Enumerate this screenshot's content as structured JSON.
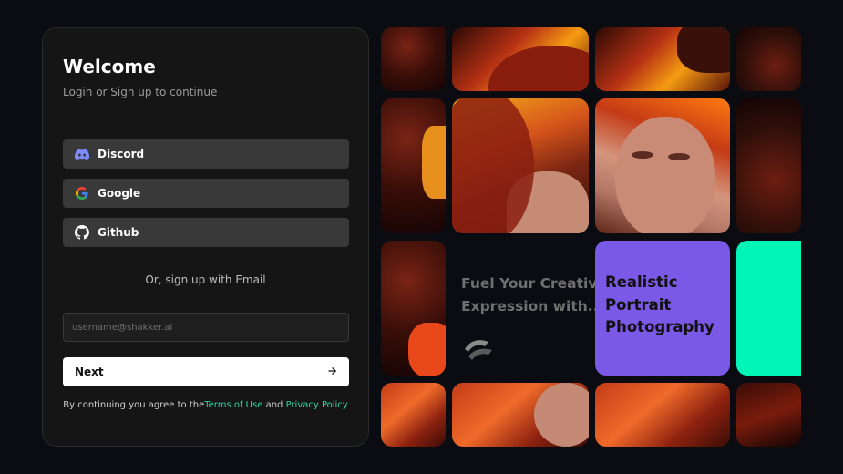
{
  "auth": {
    "title": "Welcome",
    "subtitle": "Login or Sign up to continue",
    "providers": [
      {
        "label": "Discord",
        "icon": "discord-icon"
      },
      {
        "label": "Google",
        "icon": "google-icon"
      },
      {
        "label": "Github",
        "icon": "github-icon"
      }
    ],
    "divider": "Or, sign up with Email",
    "email_placeholder": "username@shakker.ai",
    "next_label": "Next",
    "terms_prefix": "By continuing you agree to the",
    "terms_link": "Terms of Use",
    "terms_and": "and",
    "privacy_link": "Privacy Policy"
  },
  "showcase": {
    "promo_line1": "Fuel Your Creative",
    "promo_line2": "Expression with...",
    "promo_logo": "shakker-logo-icon",
    "feature_line1": "Realistic",
    "feature_line2": "Portrait",
    "feature_line3": "Photography"
  },
  "colors": {
    "background": "#0b0c12",
    "panel": "#151515",
    "button": "#393939",
    "accent_link": "#2fd3a3",
    "feature_purple": "#7a59e6",
    "feature_mint": "#00f5b6"
  }
}
